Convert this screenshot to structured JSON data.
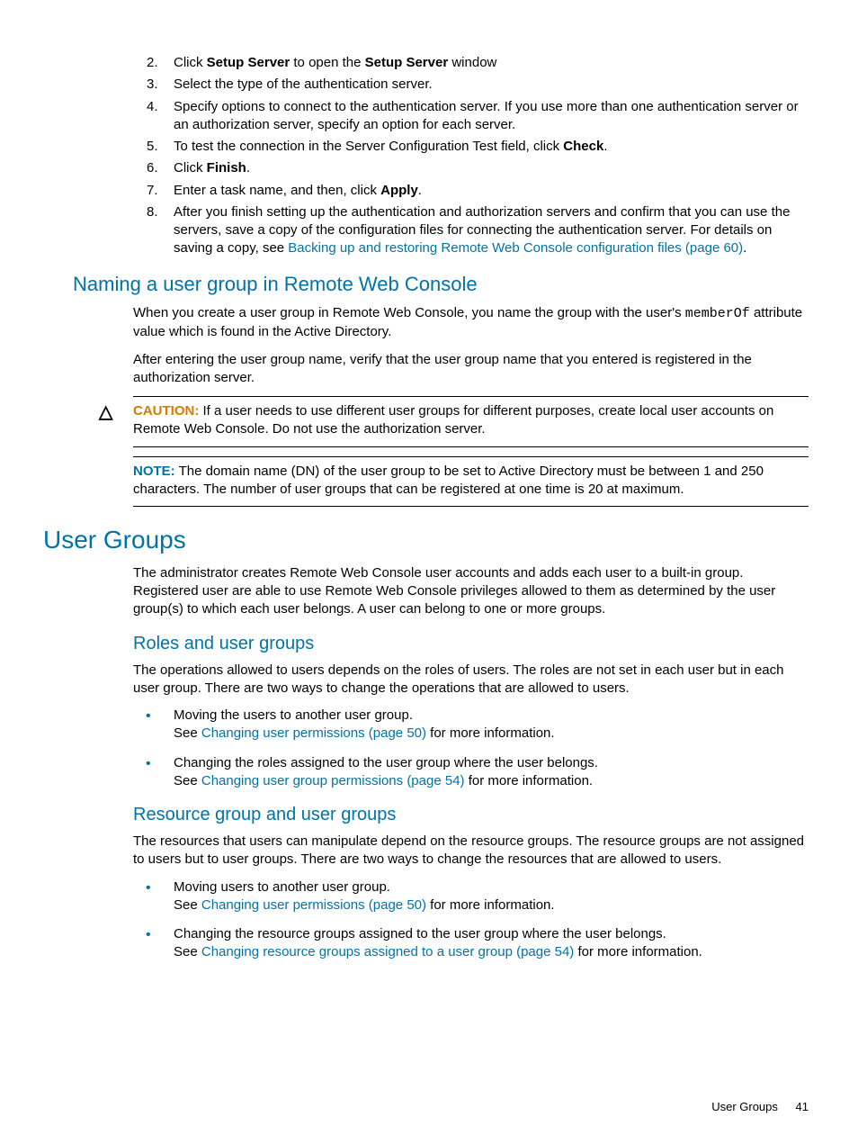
{
  "steps": {
    "s2_a": "Click ",
    "s2_b": "Setup Server",
    "s2_c": " to open the ",
    "s2_d": "Setup Server",
    "s2_e": " window",
    "s3": "Select the type of the authentication server.",
    "s4": "Specify options to connect to the authentication server. If you use more than one authentication server or an authorization server, specify an option for each server.",
    "s5_a": "To test the connection in the Server Configuration Test field, click ",
    "s5_b": "Check",
    "s5_c": ".",
    "s6_a": "Click ",
    "s6_b": "Finish",
    "s6_c": ".",
    "s7_a": "Enter a task name, and then, click ",
    "s7_b": "Apply",
    "s7_c": ".",
    "s8_a": "After you finish setting up the authentication and authorization servers and confirm that you can use the servers, save a copy of the configuration files for connecting the authentication server. For details on saving a copy, see ",
    "s8_link": "Backing up and restoring Remote Web Console configuration files (page 60)",
    "s8_c": "."
  },
  "naming": {
    "heading": "Naming a user group in Remote Web Console",
    "p1_a": "When you create a user group in Remote Web Console, you name the group with the user's ",
    "p1_mono": "memberOf",
    "p1_b": " attribute value which is found in the Active Directory.",
    "p2": "After entering the user group name, verify that the user group name that you entered is registered in the authorization server.",
    "caution_label": "CAUTION:",
    "caution_body": "   If a user needs to use different user groups for different purposes, create local user accounts on Remote Web Console. Do not use the authorization server.",
    "note_label": "NOTE:",
    "note_body": "   The domain name (DN) of the user group to be set to Active Directory must be between 1 and 250 characters. The number of user groups that can be registered at one time is 20 at maximum."
  },
  "usergroups": {
    "heading": "User Groups",
    "p1": "The administrator creates Remote Web Console user accounts and adds each user to a built-in group. Registered user are able to use Remote Web Console privileges allowed to them as determined by the user group(s) to which each user belongs. A user can belong to one or more groups."
  },
  "roles": {
    "heading": "Roles and user groups",
    "p1": "The operations allowed to users depends on the roles of users. The roles are not set in each user but in each user group. There are two ways to change the operations that are allowed to users.",
    "b1_line1": "Moving the users to another user group.",
    "b1_see": "See ",
    "b1_link": "Changing user permissions (page 50)",
    "b1_after": " for more information.",
    "b2_line1": "Changing the roles assigned to the user group where the user belongs.",
    "b2_see": "See ",
    "b2_link": "Changing user group permissions (page 54)",
    "b2_after": " for more information."
  },
  "resource": {
    "heading": "Resource group and user groups",
    "p1": "The resources that users can manipulate depend on the resource groups. The resource groups are not assigned to users but to user groups. There are two ways to change the resources that are allowed to users.",
    "b1_line1": "Moving users to another user group.",
    "b1_see": "See ",
    "b1_link": "Changing user permissions (page 50)",
    "b1_after": " for more information.",
    "b2_line1": "Changing the resource groups assigned to the user group where the user belongs.",
    "b2_see": "See ",
    "b2_link": "Changing resource groups assigned to a user group (page 54)",
    "b2_after": " for more information."
  },
  "footer": {
    "title": "User Groups",
    "pagenum": "41"
  },
  "icons": {
    "caution": "△"
  }
}
